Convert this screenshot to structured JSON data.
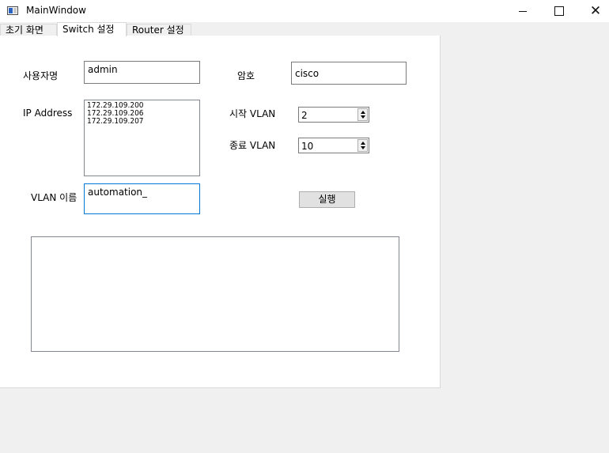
{
  "window": {
    "title": "MainWindow"
  },
  "tabs": [
    {
      "label": "초기 화면"
    },
    {
      "label": "Switch 설정"
    },
    {
      "label": "Router 설정"
    }
  ],
  "form": {
    "username_label": "사용자명",
    "username_value": "admin",
    "password_label": "암호",
    "password_value": "cisco",
    "ip_label": "IP Address",
    "ip_lines": [
      "172.29.109.200",
      "172.29.109.206",
      "172.29.109.207"
    ],
    "start_vlan_label": "시작 VLAN",
    "start_vlan_value": "2",
    "end_vlan_label": "종료 VLAN",
    "end_vlan_value": "10",
    "vlan_name_label": "VLAN 이름",
    "vlan_name_value": "automation_",
    "run_button": "실행",
    "output_text": ""
  }
}
